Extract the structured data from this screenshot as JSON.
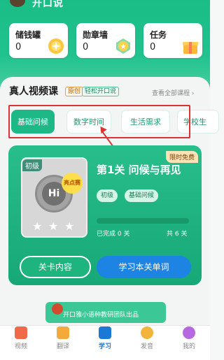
{
  "header": {
    "title": "开口说"
  },
  "stats": [
    {
      "label": "储钱罐",
      "value": "0"
    },
    {
      "label": "勋章墙",
      "value": "0"
    },
    {
      "label": "任务",
      "value": "0"
    }
  ],
  "section": {
    "title": "真人视频课",
    "tag_original": "原创",
    "tag_easy": "轻松开口说",
    "all_link": "查看全部课程 ›"
  },
  "tabs": [
    "基础问候",
    "数字时间",
    "生活需求",
    "学校生"
  ],
  "lesson": {
    "free_badge": "限时免费",
    "level_badge": "初级",
    "new_badge": "亮点赛",
    "hi_text": "Hi",
    "title": "第1关 问候与再见",
    "chips": [
      "初级",
      "基础问候"
    ],
    "progress_fraction": 0,
    "done_text": "已完成 0 关",
    "total_text": "共 6 关",
    "btn_outline": "关卡内容",
    "btn_fill": "学习本关单词"
  },
  "footer": {
    "text": "开口雅小语种教研团队出品"
  },
  "nav": [
    {
      "label": "视频"
    },
    {
      "label": "翻译"
    },
    {
      "label": "学习"
    },
    {
      "label": "发音"
    },
    {
      "label": "我的"
    }
  ],
  "colors": {
    "accent": "#1eb886",
    "primary_blue": "#1d84e3",
    "highlight": "#dd3333"
  }
}
